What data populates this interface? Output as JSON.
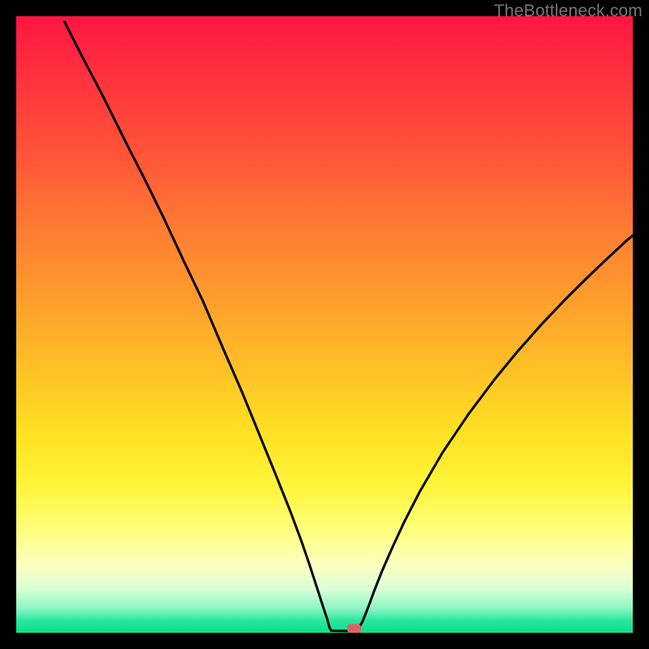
{
  "watermark": "TheBottleneck.com",
  "chart_data": {
    "type": "line",
    "title": "",
    "xlabel": "",
    "ylabel": "",
    "xlim": [
      0,
      100
    ],
    "ylim": [
      0,
      100
    ],
    "grid": false,
    "legend": false,
    "curve_points": [
      {
        "x": 7.83,
        "y": 99.11
      },
      {
        "x": 10.77,
        "y": 93.31
      },
      {
        "x": 14.13,
        "y": 86.91
      },
      {
        "x": 17.7,
        "y": 79.71
      },
      {
        "x": 20.86,
        "y": 73.51
      },
      {
        "x": 24.01,
        "y": 67.11
      },
      {
        "x": 27.17,
        "y": 60.29
      },
      {
        "x": 30.33,
        "y": 53.69
      },
      {
        "x": 33.49,
        "y": 46.25
      },
      {
        "x": 36.64,
        "y": 39.01
      },
      {
        "x": 39.8,
        "y": 31.26
      },
      {
        "x": 42.11,
        "y": 25.59
      },
      {
        "x": 44.42,
        "y": 19.8
      },
      {
        "x": 46.26,
        "y": 14.85
      },
      {
        "x": 47.52,
        "y": 11.18
      },
      {
        "x": 48.78,
        "y": 7.3
      },
      {
        "x": 49.83,
        "y": 4.04
      },
      {
        "x": 50.46,
        "y": 2.16
      },
      {
        "x": 50.8,
        "y": 0.85
      },
      {
        "x": 51.1,
        "y": 0.35
      },
      {
        "x": 52.5,
        "y": 0.3
      },
      {
        "x": 54.5,
        "y": 0.3
      },
      {
        "x": 55.5,
        "y": 0.7
      },
      {
        "x": 56.13,
        "y": 1.74
      },
      {
        "x": 57.18,
        "y": 4.38
      },
      {
        "x": 58.02,
        "y": 6.69
      },
      {
        "x": 59.28,
        "y": 9.88
      },
      {
        "x": 60.97,
        "y": 13.75
      },
      {
        "x": 62.86,
        "y": 17.83
      },
      {
        "x": 65.38,
        "y": 22.76
      },
      {
        "x": 69.17,
        "y": 29.27
      },
      {
        "x": 73.38,
        "y": 35.5
      },
      {
        "x": 77.59,
        "y": 41.1
      },
      {
        "x": 81.38,
        "y": 45.71
      },
      {
        "x": 85.36,
        "y": 50.2
      },
      {
        "x": 88.94,
        "y": 53.95
      },
      {
        "x": 92.51,
        "y": 57.5
      },
      {
        "x": 95.88,
        "y": 60.71
      },
      {
        "x": 98.82,
        "y": 63.45
      },
      {
        "x": 100.0,
        "y": 64.45
      }
    ],
    "marker": {
      "x": 54.8,
      "y": 0.7,
      "shape": "rounded-rect",
      "color": "#d9645f"
    },
    "background_gradient": {
      "type": "vertical",
      "stops": [
        {
          "pos": 0.0,
          "color": "#ff1642"
        },
        {
          "pos": 0.5,
          "color": "#ffb028"
        },
        {
          "pos": 0.8,
          "color": "#fff45a"
        },
        {
          "pos": 1.0,
          "color": "#0adf8e"
        }
      ]
    }
  }
}
